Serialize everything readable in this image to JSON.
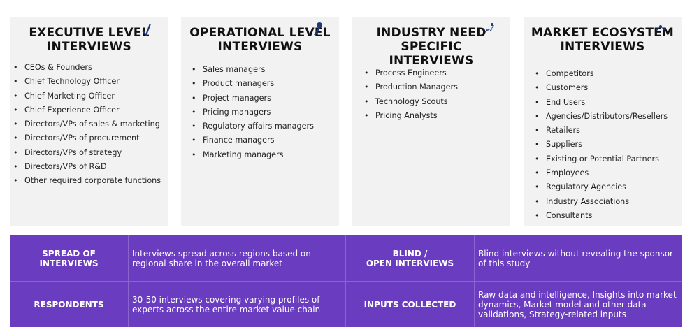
{
  "cards": [
    {
      "title_lines": [
        "EXECUTIVE LEVEL",
        "INTERVIEWS"
      ],
      "icon": "chess-piece-icon",
      "items": [
        "CEOs & Founders",
        "Chief Technology Officer",
        "Chief Marketing Officer",
        "Chief Experience Officer",
        "Directors/VPs of sales & marketing",
        "Directors/VPs of procurement",
        "Directors/VPs of strategy",
        "Directors/VPs of R&D",
        "Other required corporate functions"
      ]
    },
    {
      "title_lines": [
        "OPERATIONAL LEVEL",
        "INTERVIEWS"
      ],
      "icon": "person-gear-icon",
      "items": [
        "Sales managers",
        "Product managers",
        "Project managers",
        "Pricing managers",
        "Regulatory affairs managers",
        "Finance managers",
        "Marketing managers"
      ]
    },
    {
      "title_lines": [
        "INDUSTRY NEED",
        "SPECIFIC",
        "INTERVIEWS"
      ],
      "icon": "handshake-icon",
      "items": [
        "Process Engineers",
        "Production Managers",
        "Technology Scouts",
        "Pricing Analysts"
      ]
    },
    {
      "title_lines": [
        "MARKET ECOSYSTEM",
        "INTERVIEWS"
      ],
      "icon": "network-icon",
      "items": [
        "Competitors",
        "Customers",
        "End Users",
        "Agencies/Distributors/Resellers",
        "Retailers",
        "Suppliers",
        "Existing or Potential Partners",
        "Employees",
        "Regulatory Agencies",
        "Industry Associations",
        "Consultants"
      ]
    }
  ],
  "panel": {
    "row1": {
      "left_label_lines": [
        "SPREAD OF",
        "INTERVIEWS"
      ],
      "left_text_lines": [
        "Interviews spread across regions based on",
        "regional share in the overall market"
      ],
      "right_label_lines": [
        "BLIND /",
        "OPEN INTERVIEWS"
      ],
      "right_text_lines": [
        "Blind interviews without revealing the sponsor",
        "of this study"
      ]
    },
    "row2": {
      "left_label_lines": [
        "RESPONDENTS"
      ],
      "left_text_lines": [
        "30-50 interviews covering varying profiles of",
        "experts across the entire market value chain"
      ],
      "right_label_lines": [
        "INPUTS COLLECTED"
      ],
      "right_text_lines": [
        "Raw data and intelligence, Insights into market",
        "dynamics, Market model and other data",
        "validations, Strategy-related inputs"
      ]
    }
  },
  "colors": {
    "panel": "#6a3cbf",
    "card": "#f2f2f2",
    "icon": "#1f3a7a"
  }
}
